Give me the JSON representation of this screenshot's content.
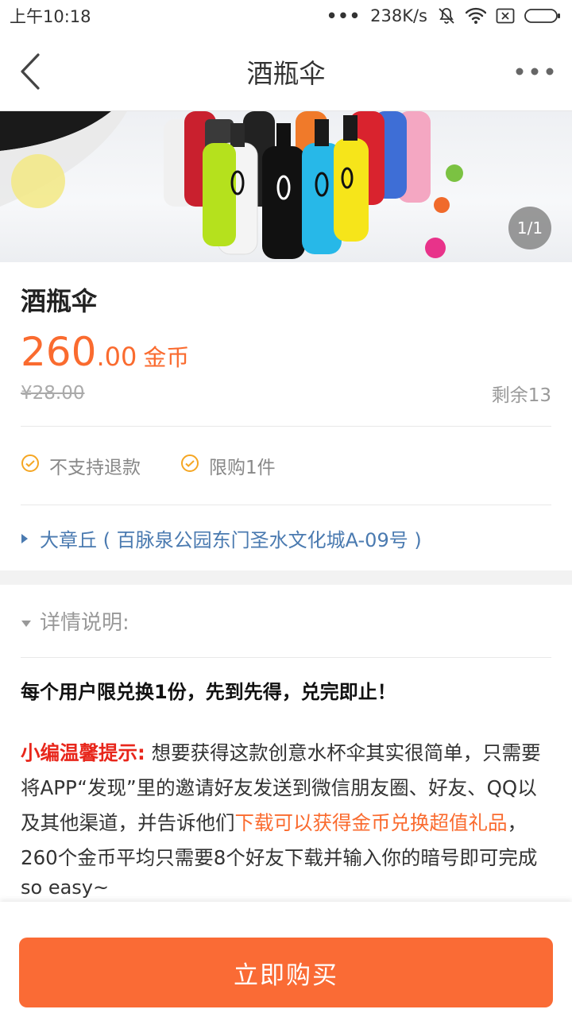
{
  "status_bar": {
    "time": "上午10:18",
    "signal_dots": "•••",
    "net_speed": "238K/s"
  },
  "nav": {
    "title": "酒瓶伞"
  },
  "gallery": {
    "pager": "1/1"
  },
  "product": {
    "name": "酒瓶伞",
    "price_int": "260",
    "price_dec": ".00",
    "price_unit": "金币",
    "original_price": "¥28.00",
    "stock": "剩余13",
    "tags": [
      "不支持退款",
      "限购1件"
    ],
    "address": "大章丘 ( 百脉泉公园东门圣水文化城A-09号 )"
  },
  "details": {
    "header": "详情说明:",
    "rule": "每个用户限兑换1份，先到先得，兑完即止！",
    "tip_label": "小编温馨提示:",
    "tip_part1": " 想要获得这款创意水杯伞其实很简单，只需要将APP“发现”里的邀请好友发送到微信朋友圈、好友、QQ以及其他渠道，并告诉他们",
    "tip_highlight": "下载可以获得金币兑换超值礼品",
    "tip_part2": "，260个金币平均只需要8个好友下载并输入你的暗号即可完成",
    "tip_tail": "so easy~"
  },
  "actions": {
    "buy_label": "立即购买"
  },
  "colors": {
    "accent": "#fa6b2f",
    "link": "#4a7ab0",
    "warning_red": "#e8261b"
  }
}
